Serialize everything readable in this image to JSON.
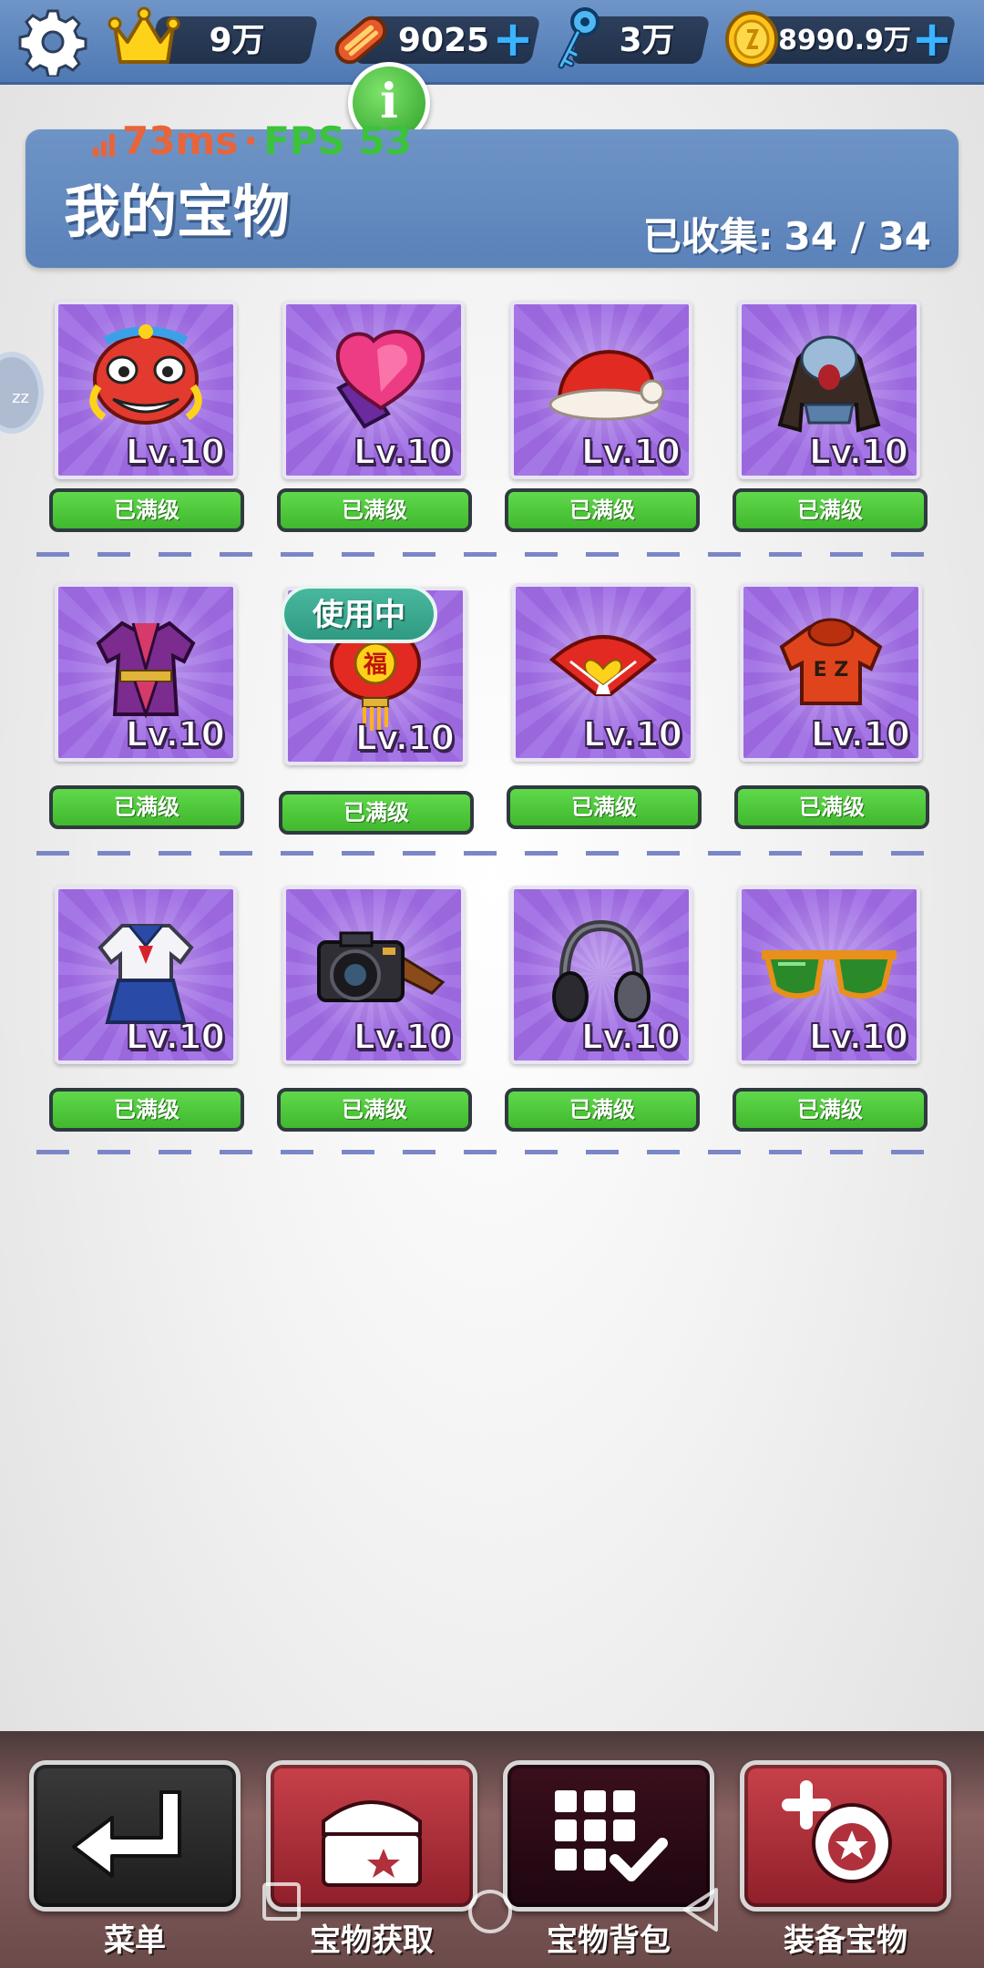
{
  "topbar": {
    "crowns": "9万",
    "boards": "9025",
    "keys": "3万",
    "coins": "8990.9万",
    "icons": [
      "gear-icon",
      "crown-icon",
      "hoverboard-icon",
      "key-icon",
      "coin-icon",
      "plus-icon",
      "info-icon"
    ]
  },
  "net": {
    "ping": "73ms",
    "separator": "·",
    "fps": "FPS 53"
  },
  "panel": {
    "title": "我的宝物",
    "collected_label": "已收集:",
    "collected_value": "34 / 34"
  },
  "side": {
    "ring_text": "zz"
  },
  "items": [
    {
      "name": "lion-dance-mask",
      "level": "Lv.10",
      "status": "已满级"
    },
    {
      "name": "purple-heart-ring",
      "level": "Lv.10",
      "status": "已满级"
    },
    {
      "name": "santa-hat",
      "level": "Lv.10",
      "status": "已满级"
    },
    {
      "name": "hooded-jacket",
      "level": "Lv.10",
      "status": "已满级"
    },
    {
      "name": "purple-robe",
      "level": "Lv.10",
      "status": "已满级"
    },
    {
      "name": "fu-lantern",
      "level": "Lv.10",
      "status": "已满级",
      "badge": "使用中"
    },
    {
      "name": "heart-fan",
      "level": "Lv.10",
      "status": "已满级"
    },
    {
      "name": "ez-hoodie",
      "level": "Lv.10",
      "status": "已满级"
    },
    {
      "name": "sailor-uniform",
      "level": "Lv.10",
      "status": "已满级"
    },
    {
      "name": "camera",
      "level": "Lv.10",
      "status": "已满级"
    },
    {
      "name": "headphones",
      "level": "Lv.10",
      "status": "已满级"
    },
    {
      "name": "sunglasses",
      "level": "Lv.10",
      "status": "已满级"
    }
  ],
  "nav": [
    {
      "label": "菜单",
      "icon": "return-arrow-icon"
    },
    {
      "label": "宝物获取",
      "icon": "treasure-chest-icon"
    },
    {
      "label": "宝物背包",
      "icon": "grid-check-icon"
    },
    {
      "label": "装备宝物",
      "icon": "equip-treasure-icon"
    }
  ],
  "colors": {
    "topbar": "#5b82b9",
    "button_green": "#4fc83a",
    "card_purple": "#a06de0",
    "nav_red": "#b0303c",
    "nav_dark": "#2a1018"
  }
}
